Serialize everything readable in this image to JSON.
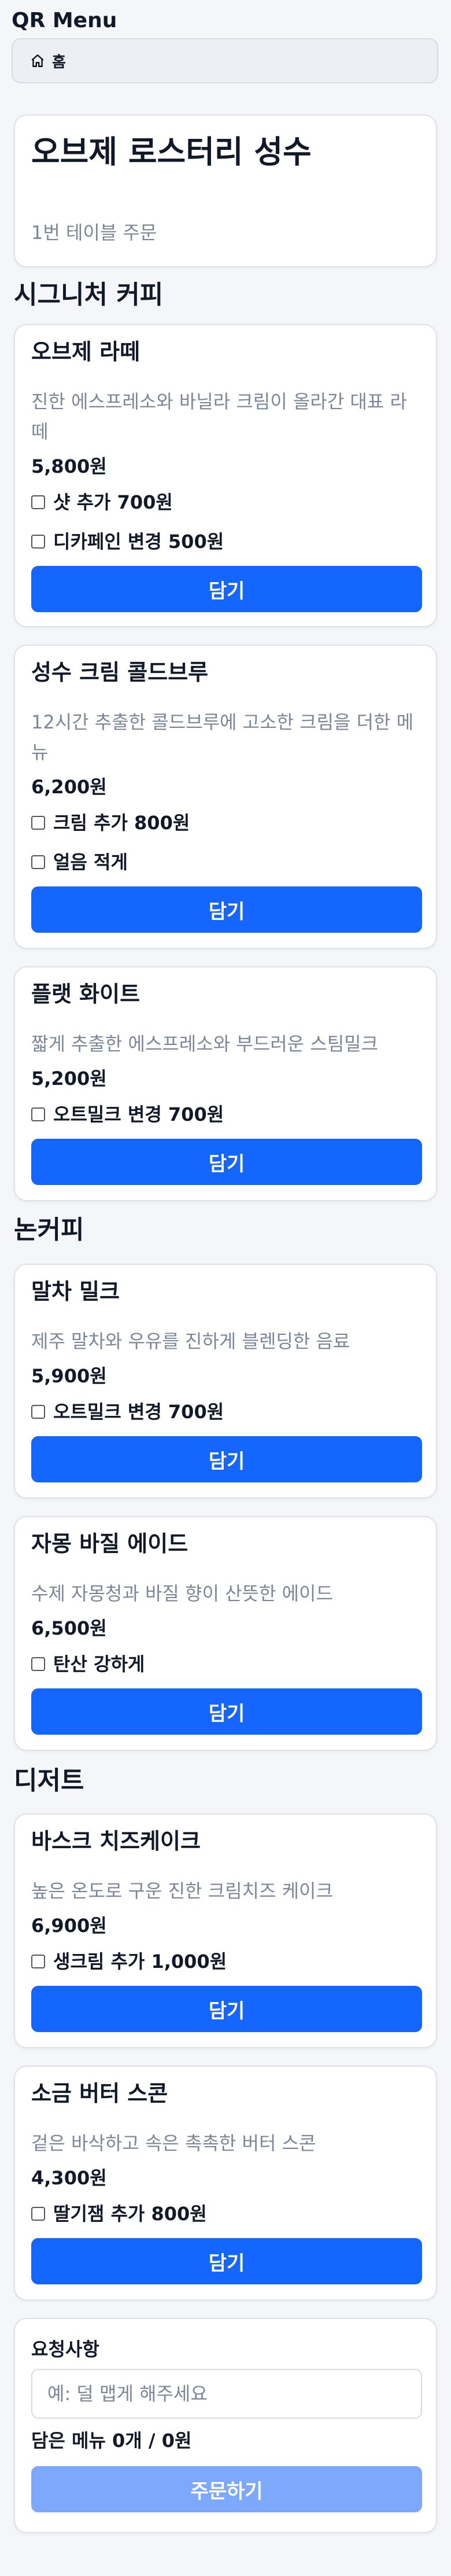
{
  "app": {
    "title": "QR Menu"
  },
  "breadcrumb": {
    "home_label": "홈"
  },
  "store": {
    "name": "오브제 로스터리 성수",
    "table_info": "1번 테이블 주문"
  },
  "sections": [
    {
      "title": "시그니처 커피",
      "items": [
        {
          "name": "오브제 라떼",
          "description": "진한 에스프레소와 바닐라 크림이 올라간 대표 라떼",
          "price": "5,800원",
          "options": [
            "샷 추가 700원",
            "디카페인 변경 500원"
          ],
          "button": "담기"
        },
        {
          "name": "성수 크림 콜드브루",
          "description": "12시간 추출한 콜드브루에 고소한 크림을 더한 메뉴",
          "price": "6,200원",
          "options": [
            "크림 추가 800원",
            "얼음 적게"
          ],
          "button": "담기"
        },
        {
          "name": "플랫 화이트",
          "description": "짧게 추출한 에스프레소와 부드러운 스팀밀크",
          "price": "5,200원",
          "options": [
            "오트밀크 변경 700원"
          ],
          "button": "담기"
        }
      ]
    },
    {
      "title": "논커피",
      "items": [
        {
          "name": "말차 밀크",
          "description": "제주 말차와 우유를 진하게 블렌딩한 음료",
          "price": "5,900원",
          "options": [
            "오트밀크 변경 700원"
          ],
          "button": "담기"
        },
        {
          "name": "자몽 바질 에이드",
          "description": "수제 자몽청과 바질 향이 산뜻한 에이드",
          "price": "6,500원",
          "options": [
            "탄산 강하게"
          ],
          "button": "담기"
        }
      ]
    },
    {
      "title": "디저트",
      "items": [
        {
          "name": "바스크 치즈케이크",
          "description": "높은 온도로 구운 진한 크림치즈 케이크",
          "price": "6,900원",
          "options": [
            "생크림 추가 1,000원"
          ],
          "button": "담기"
        },
        {
          "name": "소금 버터 스콘",
          "description": "겉은 바삭하고 속은 촉촉한 버터 스콘",
          "price": "4,300원",
          "options": [
            "딸기잼 추가 800원"
          ],
          "button": "담기"
        }
      ]
    }
  ],
  "order": {
    "request_label": "요청사항",
    "request_placeholder": "예: 덜 맵게 해주세요",
    "summary": "담은 메뉴 0개 / 0원",
    "submit_label": "주문하기"
  },
  "colors": {
    "accent": "#1565ff",
    "accent_disabled": "#7ea8fb",
    "muted_text": "#7b8796"
  }
}
